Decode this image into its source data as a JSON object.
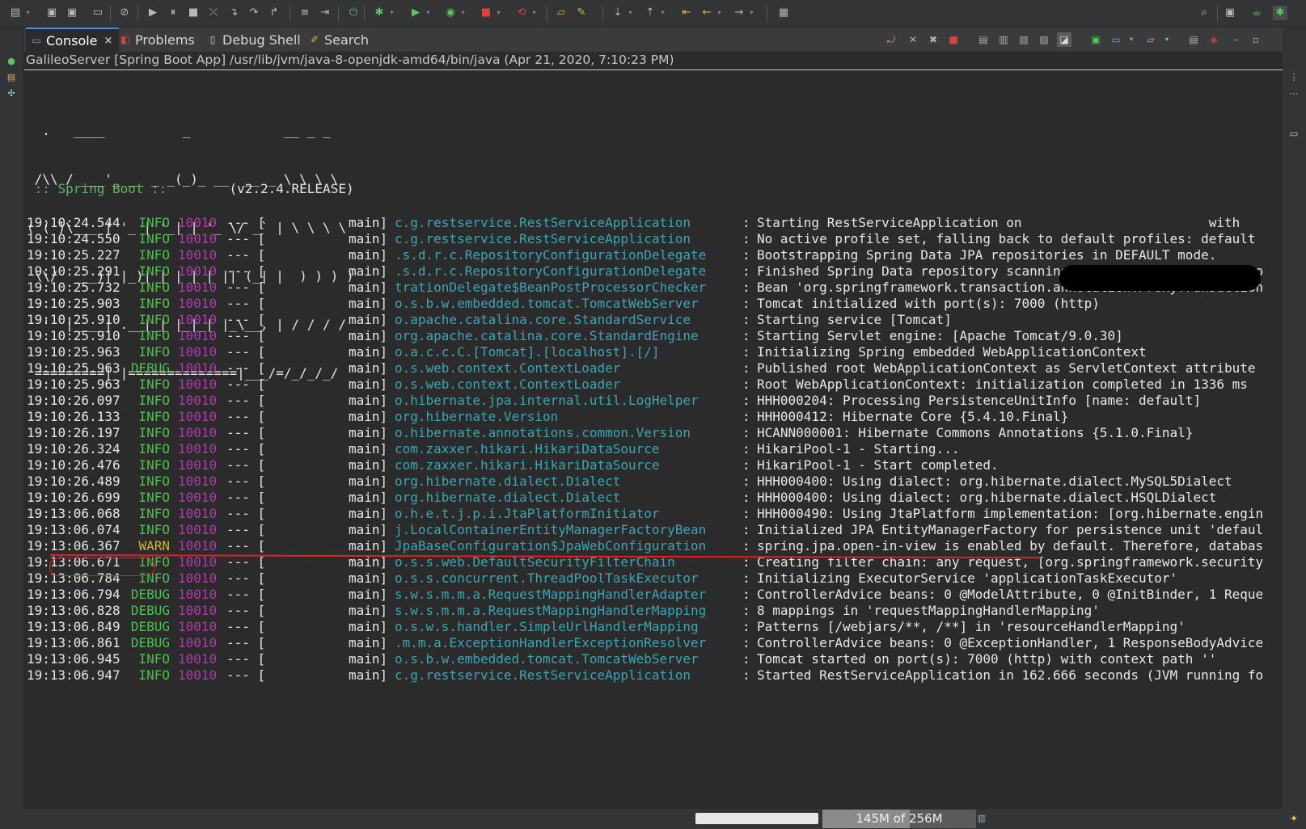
{
  "tabs": [
    {
      "id": "console",
      "label": "Console",
      "icon": "console-icon",
      "active": true,
      "closable": true
    },
    {
      "id": "problems",
      "label": "Problems",
      "icon": "problems-icon"
    },
    {
      "id": "debug-shell",
      "label": "Debug Shell",
      "icon": "debug-shell-icon"
    },
    {
      "id": "search",
      "label": "Search",
      "icon": "search-icon"
    }
  ],
  "close_glyph": "×",
  "launch_title": "GalileoServer [Spring Boot App] /usr/lib/jvm/java-8-openjdk-amd64/bin/java (Apr 21, 2020, 7:10:23 PM)",
  "banner_lines": [
    "  .   ____          _            __ _ _",
    " /\\\\ / ___'_ __ _ _(_)_ __  __ _ \\ \\ \\ \\",
    "( ( )\\___ | '_ | '_| | '_ \\/ _` | \\ \\ \\ \\",
    " \\\\/  ___)| |_)| | | | | || (_| |  ) ) ) )",
    "  '  |____| .__|_| |_|_| |_\\__, | / / / /",
    " =========|_|==============|___/=/_/_/_/"
  ],
  "boot": {
    "label": " :: Spring Boot :: ",
    "version": "       (v2.2.4.RELEASE)"
  },
  "log_rows": [
    {
      "time": "19:10:24.544",
      "level": "INFO",
      "pid": "10010",
      "sep": "--- [",
      "thread": "main]",
      "logger": "c.g.restservice.RestServiceApplication",
      "msg": "Starting RestServiceApplication on                        with"
    },
    {
      "time": "19:10:24.550",
      "level": "INFO",
      "pid": "10010",
      "sep": "--- [",
      "thread": "main]",
      "logger": "c.g.restservice.RestServiceApplication",
      "msg": "No active profile set, falling back to default profiles: default"
    },
    {
      "time": "19:10:25.227",
      "level": "INFO",
      "pid": "10010",
      "sep": "--- [",
      "thread": "main]",
      "logger": ".s.d.r.c.RepositoryConfigurationDelegate",
      "msg": "Bootstrapping Spring Data JPA repositories in DEFAULT mode."
    },
    {
      "time": "19:10:25.291",
      "level": "INFO",
      "pid": "10010",
      "sep": "--- [",
      "thread": "main]",
      "logger": ".s.d.r.c.RepositoryConfigurationDelegate",
      "msg": "Finished Spring Data repository scanning in 55ms. Found 2 JPA rep"
    },
    {
      "time": "19:10:25.732",
      "level": "INFO",
      "pid": "10010",
      "sep": "--- [",
      "thread": "main]",
      "logger": "trationDelegate$BeanPostProcessorChecker",
      "msg": "Bean 'org.springframework.transaction.annotation.ProxyTransaction"
    },
    {
      "time": "19:10:25.903",
      "level": "INFO",
      "pid": "10010",
      "sep": "--- [",
      "thread": "main]",
      "logger": "o.s.b.w.embedded.tomcat.TomcatWebServer",
      "msg": "Tomcat initialized with port(s): 7000 (http)"
    },
    {
      "time": "19:10:25.910",
      "level": "INFO",
      "pid": "10010",
      "sep": "--- [",
      "thread": "main]",
      "logger": "o.apache.catalina.core.StandardService",
      "msg": "Starting service [Tomcat]"
    },
    {
      "time": "19:10:25.910",
      "level": "INFO",
      "pid": "10010",
      "sep": "--- [",
      "thread": "main]",
      "logger": "org.apache.catalina.core.StandardEngine",
      "msg": "Starting Servlet engine: [Apache Tomcat/9.0.30]"
    },
    {
      "time": "19:10:25.963",
      "level": "INFO",
      "pid": "10010",
      "sep": "--- [",
      "thread": "main]",
      "logger": "o.a.c.c.C.[Tomcat].[localhost].[/]",
      "msg": "Initializing Spring embedded WebApplicationContext"
    },
    {
      "time": "19:10:25.963",
      "level": "DEBUG",
      "pid": "10010",
      "sep": "--- [",
      "thread": "main]",
      "logger": "o.s.web.context.ContextLoader",
      "msg": "Published root WebApplicationContext as ServletContext attribute"
    },
    {
      "time": "19:10:25.963",
      "level": "INFO",
      "pid": "10010",
      "sep": "--- [",
      "thread": "main]",
      "logger": "o.s.web.context.ContextLoader",
      "msg": "Root WebApplicationContext: initialization completed in 1336 ms"
    },
    {
      "time": "19:10:26.097",
      "level": "INFO",
      "pid": "10010",
      "sep": "--- [",
      "thread": "main]",
      "logger": "o.hibernate.jpa.internal.util.LogHelper",
      "msg": "HHH000204: Processing PersistenceUnitInfo [name: default]"
    },
    {
      "time": "19:10:26.133",
      "level": "INFO",
      "pid": "10010",
      "sep": "--- [",
      "thread": "main]",
      "logger": "org.hibernate.Version",
      "msg": "HHH000412: Hibernate Core {5.4.10.Final}"
    },
    {
      "time": "19:10:26.197",
      "level": "INFO",
      "pid": "10010",
      "sep": "--- [",
      "thread": "main]",
      "logger": "o.hibernate.annotations.common.Version",
      "msg": "HCANN000001: Hibernate Commons Annotations {5.1.0.Final}"
    },
    {
      "time": "19:10:26.324",
      "level": "INFO",
      "pid": "10010",
      "sep": "--- [",
      "thread": "main]",
      "logger": "com.zaxxer.hikari.HikariDataSource",
      "msg": "HikariPool-1 - Starting..."
    },
    {
      "time": "19:10:26.476",
      "level": "INFO",
      "pid": "10010",
      "sep": "--- [",
      "thread": "main]",
      "logger": "com.zaxxer.hikari.HikariDataSource",
      "msg": "HikariPool-1 - Start completed."
    },
    {
      "time": "19:10:26.489",
      "level": "INFO",
      "pid": "10010",
      "sep": "--- [",
      "thread": "main]",
      "logger": "org.hibernate.dialect.Dialect",
      "msg": "HHH000400: Using dialect: org.hibernate.dialect.MySQL5Dialect"
    },
    {
      "time": "19:10:26.699",
      "level": "INFO",
      "pid": "10010",
      "sep": "--- [",
      "thread": "main]",
      "logger": "org.hibernate.dialect.Dialect",
      "msg": "HHH000400: Using dialect: org.hibernate.dialect.HSQLDialect"
    },
    {
      "time": "19:13:06.068",
      "level": "INFO",
      "pid": "10010",
      "sep": "--- [",
      "thread": "main]",
      "logger": "o.h.e.t.j.p.i.JtaPlatformInitiator",
      "msg": "HHH000490: Using JtaPlatform implementation: [org.hibernate.engin"
    },
    {
      "time": "19:13:06.074",
      "level": "INFO",
      "pid": "10010",
      "sep": "--- [",
      "thread": "main]",
      "logger": "j.LocalContainerEntityManagerFactoryBean",
      "msg": "Initialized JPA EntityManagerFactory for persistence unit 'defaul"
    },
    {
      "time": "19:13:06.367",
      "level": "WARN",
      "pid": "10010",
      "sep": "--- [",
      "thread": "main]",
      "logger": "JpaBaseConfiguration$JpaWebConfiguration",
      "msg": "spring.jpa.open-in-view is enabled by default. Therefore, databas"
    },
    {
      "time": "19:13:06.671",
      "level": "INFO",
      "pid": "10010",
      "sep": "--- [",
      "thread": "main]",
      "logger": "o.s.s.web.DefaultSecurityFilterChain",
      "msg": "Creating filter chain: any request, [org.springframework.security"
    },
    {
      "time": "19:13:06.784",
      "level": "INFO",
      "pid": "10010",
      "sep": "--- [",
      "thread": "main]",
      "logger": "o.s.s.concurrent.ThreadPoolTaskExecutor",
      "msg": "Initializing ExecutorService 'applicationTaskExecutor'"
    },
    {
      "time": "19:13:06.794",
      "level": "DEBUG",
      "pid": "10010",
      "sep": "--- [",
      "thread": "main]",
      "logger": "s.w.s.m.m.a.RequestMappingHandlerAdapter",
      "msg": "ControllerAdvice beans: 0 @ModelAttribute, 0 @InitBinder, 1 Reque"
    },
    {
      "time": "19:13:06.828",
      "level": "DEBUG",
      "pid": "10010",
      "sep": "--- [",
      "thread": "main]",
      "logger": "s.w.s.m.m.a.RequestMappingHandlerMapping",
      "msg": "8 mappings in 'requestMappingHandlerMapping'"
    },
    {
      "time": "19:13:06.849",
      "level": "DEBUG",
      "pid": "10010",
      "sep": "--- [",
      "thread": "main]",
      "logger": "o.s.w.s.handler.SimpleUrlHandlerMapping",
      "msg": "Patterns [/webjars/**, /**] in 'resourceHandlerMapping'"
    },
    {
      "time": "19:13:06.861",
      "level": "DEBUG",
      "pid": "10010",
      "sep": "--- [",
      "thread": "main]",
      "logger": ".m.m.a.ExceptionHandlerExceptionResolver",
      "msg": "ControllerAdvice beans: 0 @ExceptionHandler, 1 ResponseBodyAdvice"
    },
    {
      "time": "19:13:06.945",
      "level": "INFO",
      "pid": "10010",
      "sep": "--- [",
      "thread": "main]",
      "logger": "o.s.b.w.embedded.tomcat.TomcatWebServer",
      "msg": "Tomcat started on port(s): 7000 (http) with context path ''"
    },
    {
      "time": "19:13:06.947",
      "level": "INFO",
      "pid": "10010",
      "sep": "--- [",
      "thread": "main]",
      "logger": "c.g.restservice.RestServiceApplication",
      "msg": "Started RestServiceApplication in 162.666 seconds (JVM running fo"
    }
  ],
  "log_colon": ":",
  "statusbar": {
    "heap_label": "145M of 256M",
    "heap_used_mb": 145,
    "heap_total_mb": 256
  },
  "colors": {
    "background": "#2b2b2b",
    "info": "#4ec24e",
    "warn": "#c9b82b",
    "pid": "#b03ab0",
    "logger": "#3aa6b8",
    "annotation": "#e02020"
  }
}
